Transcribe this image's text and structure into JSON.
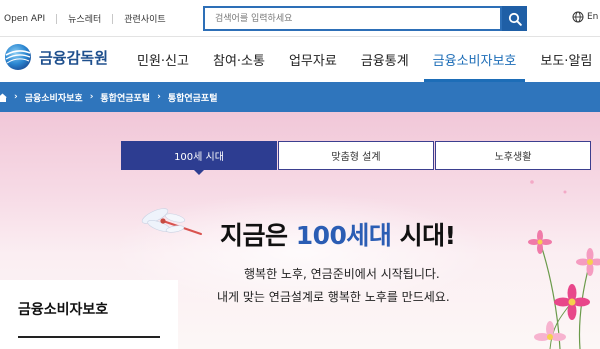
{
  "utility": {
    "links": [
      {
        "label": "Open API"
      },
      {
        "label": "뉴스레터"
      },
      {
        "label": "관련사이트"
      }
    ],
    "search_placeholder": "검색어를 입력하세요",
    "lang_label": "En"
  },
  "header": {
    "logo_text": "금융감독원",
    "nav": [
      {
        "label": "민원·신고",
        "active": false
      },
      {
        "label": "참여·소통",
        "active": false
      },
      {
        "label": "업무자료",
        "active": false
      },
      {
        "label": "금융통계",
        "active": false
      },
      {
        "label": "금융소비자보호",
        "active": true
      },
      {
        "label": "보도·알림",
        "active": false
      }
    ]
  },
  "breadcrumb": {
    "items": [
      "금융소비자보호",
      "통합연금포털",
      "통합연금포털"
    ]
  },
  "hero": {
    "tabs": [
      {
        "label": "100세 시대",
        "active": true
      },
      {
        "label": "맞춤형 설계",
        "active": false
      },
      {
        "label": "노후생활",
        "active": false
      }
    ],
    "headline_pre": "지금은 ",
    "headline_highlight": "100세대",
    "headline_post": " 시대!",
    "subtitle_line1": "행복한 노후, 연금준비에서 시작됩니다.",
    "subtitle_line2": "내게 맞는 연금설계로 행복한 노후를 만드세요."
  },
  "sidebar": {
    "title": "금융소비자보호"
  },
  "colors": {
    "primary": "#2d6fb7",
    "crumb_bar": "#2f75bc",
    "tab_active": "#2d3d91",
    "highlight": "#2b5db4"
  }
}
